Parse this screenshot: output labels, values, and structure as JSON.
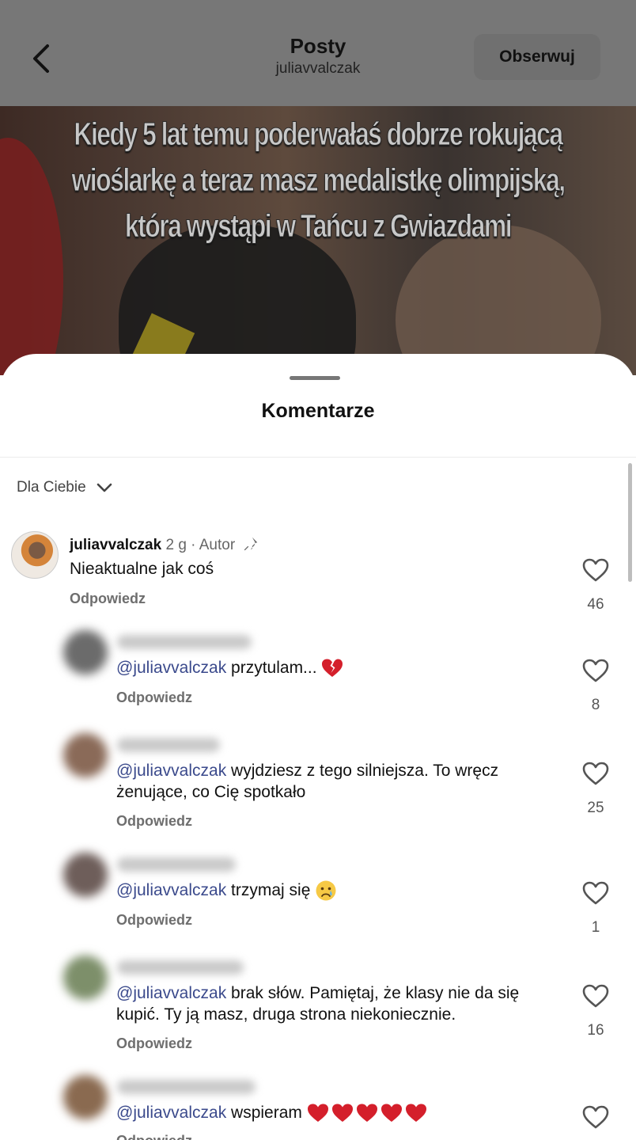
{
  "header": {
    "title": "Posty",
    "subtitle": "juliavvalczak",
    "follow_label": "Obserwuj"
  },
  "post": {
    "overlay_lines": [
      "Kiedy 5 lat temu poderwałaś dobrze rokującą",
      "wioślarkę a teraz masz medalistkę olimpijską,",
      "która wystąpi w Tańcu z Gwiazdami"
    ]
  },
  "comments_sheet": {
    "title": "Komentarze",
    "sort_label": "Dla Ciebie"
  },
  "author_comment": {
    "username": "juliavvalczak",
    "meta": "2 g · Autor",
    "text": "Nieaktualne jak coś",
    "reply_label": "Odpowiedz",
    "likes": "46"
  },
  "replies": [
    {
      "mention": "@juliavvalczak",
      "text": " przytulam... ",
      "emoji": "broken-heart",
      "reply_label": "Odpowiedz",
      "likes": "8"
    },
    {
      "mention": "@juliavvalczak",
      "text": " wyjdziesz z tego silniejsza. To wręcz żenujące, co Cię spotkało",
      "reply_label": "Odpowiedz",
      "likes": "25"
    },
    {
      "mention": "@juliavvalczak",
      "text": " trzymaj się ",
      "emoji": "crying-face",
      "reply_label": "Odpowiedz",
      "likes": "1"
    },
    {
      "mention": "@juliavvalczak",
      "text": " brak słów. Pamiętaj, że klasy nie da się kupić. Ty ją masz, druga strona niekoniecznie.",
      "reply_label": "Odpowiedz",
      "likes": "16"
    },
    {
      "mention": "@juliavvalczak",
      "text": " wspieram ",
      "emoji": "red-hearts",
      "reply_label": "Odpowiedz",
      "likes": ""
    }
  ],
  "colors": {
    "mention": "#3b4a8c",
    "heart_red": "#d41f2b",
    "header_bg": "#777777"
  },
  "icons": [
    "back-icon",
    "chevron-down-icon",
    "pin-icon",
    "heart-outline-icon",
    "broken-heart-emoji",
    "crying-face-emoji",
    "red-heart-emoji"
  ]
}
